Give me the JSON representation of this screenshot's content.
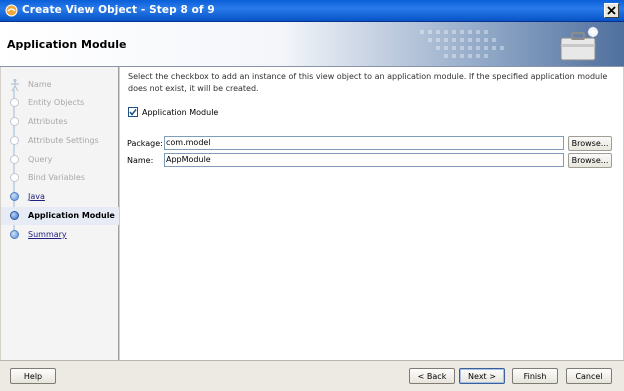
{
  "window": {
    "title": "Create View Object - Step 8 of 9"
  },
  "header": {
    "title": "Application Module"
  },
  "steps": [
    {
      "label": "Name",
      "state": "disabled"
    },
    {
      "label": "Entity Objects",
      "state": "disabled"
    },
    {
      "label": "Attributes",
      "state": "disabled"
    },
    {
      "label": "Attribute Settings",
      "state": "disabled"
    },
    {
      "label": "Query",
      "state": "disabled"
    },
    {
      "label": "Bind Variables",
      "state": "disabled"
    },
    {
      "label": "Java",
      "state": "link"
    },
    {
      "label": "Application Module",
      "state": "current"
    },
    {
      "label": "Summary",
      "state": "link"
    }
  ],
  "content": {
    "instructions": "Select the checkbox to add an instance of this view object to an application module.  If the specified application module does not exist, it will be created.",
    "checkbox": {
      "label": "Application Module",
      "checked": true
    },
    "package": {
      "label": "Package:",
      "value": "com.model",
      "browse": "Browse..."
    },
    "name": {
      "label": "Name:",
      "value": "AppModule",
      "browse": "Browse..."
    }
  },
  "footer": {
    "help": "Help",
    "back": "< Back",
    "next": "Next >",
    "finish": "Finish",
    "cancel": "Cancel"
  },
  "colors": {
    "titlebar": "#0a5fd8",
    "link": "#202080",
    "current_step_bg": "#e6ebf5"
  }
}
